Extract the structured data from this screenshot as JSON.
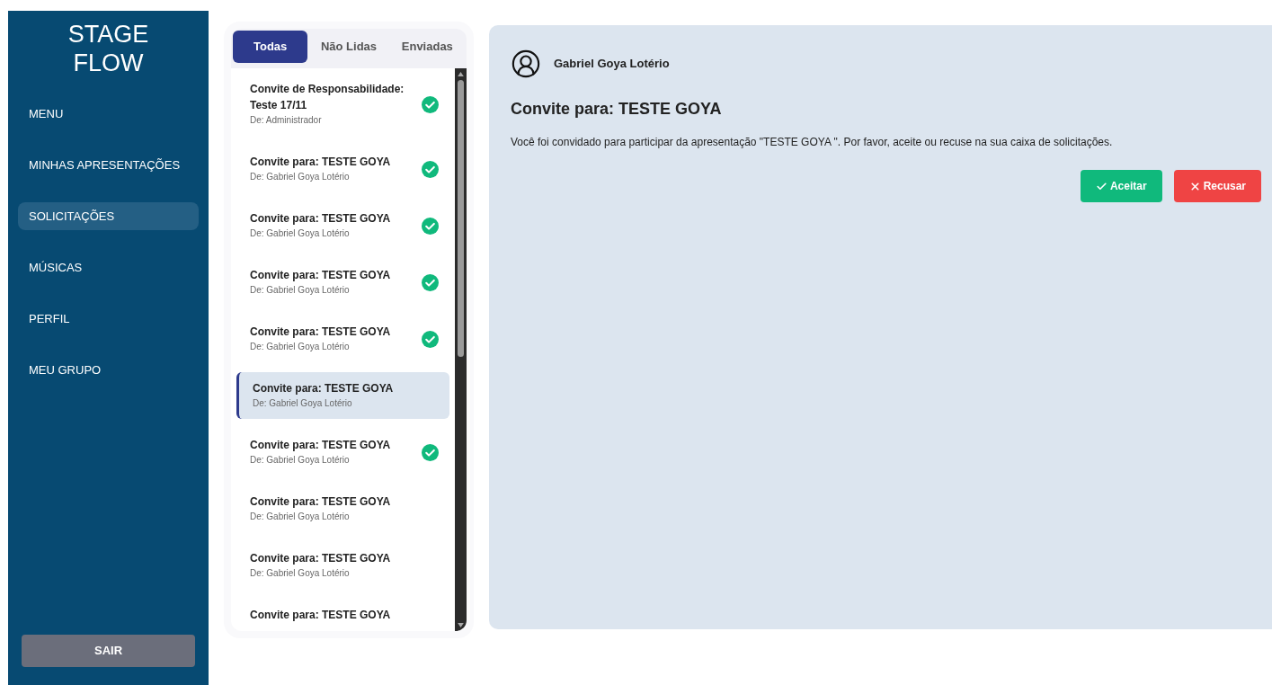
{
  "sidebar": {
    "logo": [
      "STAGE",
      "FLOW"
    ],
    "items": [
      {
        "label": "MENU",
        "selected": false
      },
      {
        "label": "MINHAS APRESENTAÇÕES",
        "selected": false
      },
      {
        "label": "SOLICITAÇÕES",
        "selected": true
      },
      {
        "label": "MÚSICAS",
        "selected": false
      },
      {
        "label": "PERFIL",
        "selected": false
      },
      {
        "label": "MEU GRUPO",
        "selected": false
      }
    ],
    "logout": "SAIR"
  },
  "tabs": [
    {
      "label": "Todas",
      "selected": true
    },
    {
      "label": "Não Lidas",
      "selected": false
    },
    {
      "label": "Enviadas",
      "selected": false
    }
  ],
  "messages": [
    {
      "title": "Convite de Responsabilidade: Teste 17/11",
      "from": "De: Administrador",
      "read": true,
      "selected": false
    },
    {
      "title": "Convite para: TESTE GOYA",
      "from": "De: Gabriel Goya Lotério",
      "read": true,
      "selected": false
    },
    {
      "title": "Convite para: TESTE GOYA",
      "from": "De: Gabriel Goya Lotério",
      "read": true,
      "selected": false
    },
    {
      "title": "Convite para: TESTE GOYA",
      "from": "De: Gabriel Goya Lotério",
      "read": true,
      "selected": false
    },
    {
      "title": "Convite para: TESTE GOYA",
      "from": "De: Gabriel Goya Lotério",
      "read": true,
      "selected": false
    },
    {
      "title": "Convite para: TESTE GOYA",
      "from": "De: Gabriel Goya Lotério",
      "read": false,
      "selected": true
    },
    {
      "title": "Convite para: TESTE GOYA",
      "from": "De: Gabriel Goya Lotério",
      "read": true,
      "selected": false
    },
    {
      "title": "Convite para: TESTE GOYA",
      "from": "De: Gabriel Goya Lotério",
      "read": false,
      "selected": false
    },
    {
      "title": "Convite para: TESTE GOYA",
      "from": "De: Gabriel Goya Lotério",
      "read": false,
      "selected": false
    },
    {
      "title": "Convite para: TESTE GOYA",
      "read": false,
      "selected": false
    }
  ],
  "detail": {
    "sender": "Gabriel Goya Lotério",
    "title": "Convite para: TESTE GOYA",
    "body": "Você foi convidado para participar da apresentação \"TESTE GOYA \". Por favor, aceite ou recuse na sua caixa de solicitações.",
    "accept": "Aceitar",
    "decline": "Recusar"
  }
}
